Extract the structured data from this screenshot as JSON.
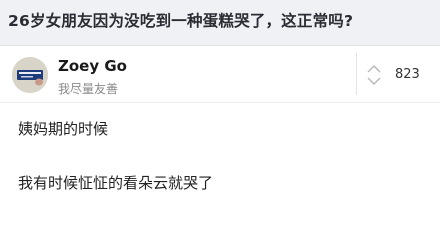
{
  "question": {
    "title": "26岁女朋友因为没吃到一种蛋糕哭了，这正常吗?"
  },
  "author": {
    "name": "Zoey Go",
    "bio": "我尽量友善",
    "avatar_icon": "profile-photo"
  },
  "vote": {
    "count": "823",
    "icon": "up-down-arrows-icon"
  },
  "answer": {
    "lines": [
      "姨妈期的时候",
      "我有时候怔怔的看朵云就哭了"
    ]
  },
  "colors": {
    "header_bg": "#f0f1f5",
    "title_text": "#2b2b33",
    "muted_text": "#8a8a8a",
    "divider": "#e4e4e4"
  }
}
